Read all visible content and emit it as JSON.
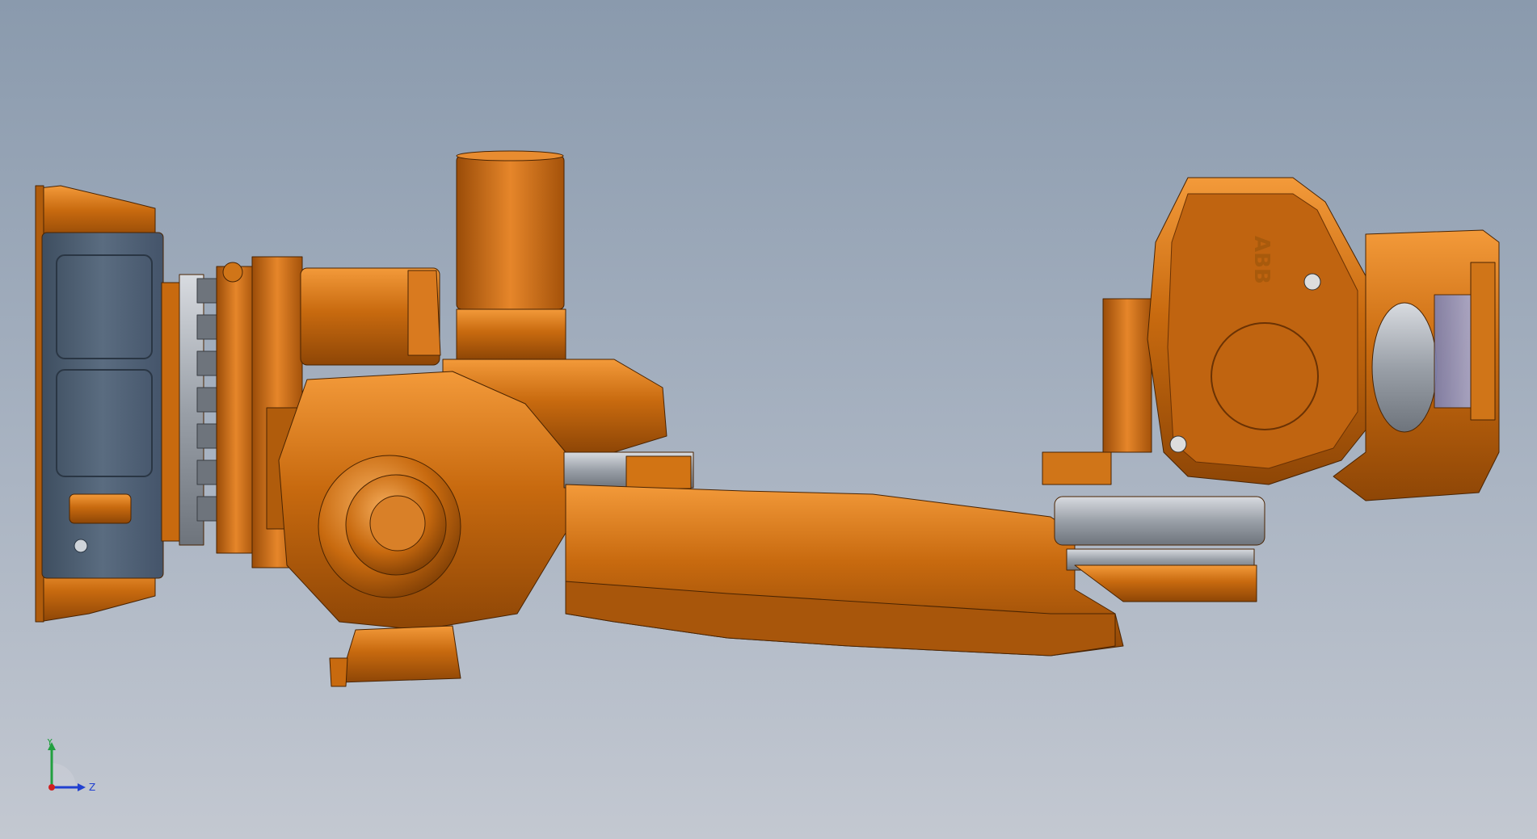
{
  "viewport": {
    "background_top": "#8a9aad",
    "background_bottom": "#c3c8d1"
  },
  "model": {
    "brand_label": "ABB",
    "primary_color": "#c86a0f",
    "shadow_color": "#8e4606",
    "highlight_color": "#f0a040",
    "panel_color": "#4f6175",
    "metal_color": "#9aa0a8",
    "glass_color": "#9a9ec8"
  },
  "triad": {
    "y_label": "Y",
    "z_label": "Z",
    "y_color": "#22a040",
    "z_color": "#2040d0",
    "origin_color": "#d02020"
  }
}
